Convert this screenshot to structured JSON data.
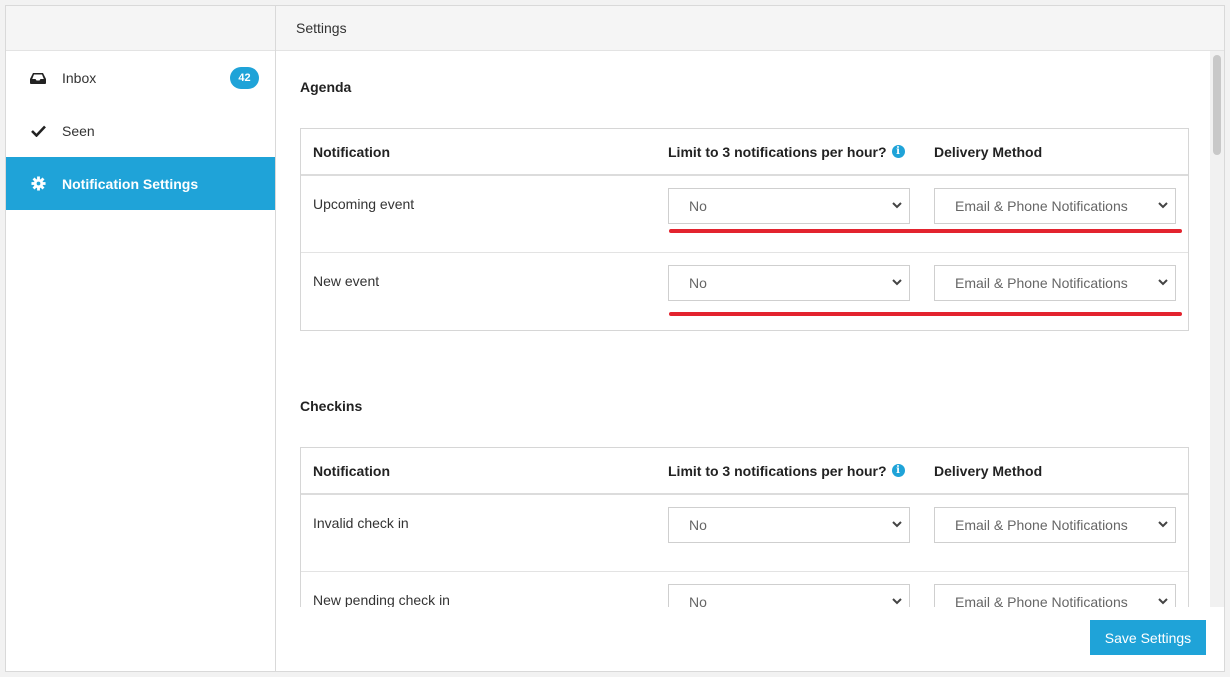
{
  "sidebar": {
    "items": [
      {
        "label": "Inbox",
        "icon": "inbox-icon",
        "badge": "42"
      },
      {
        "label": "Seen",
        "icon": "check-icon"
      },
      {
        "label": "Notification Settings",
        "icon": "gear-icon",
        "active": true
      }
    ]
  },
  "header": {
    "title": "Settings"
  },
  "columns": {
    "notification": "Notification",
    "limit": "Limit to 3 notifications per hour?",
    "delivery": "Delivery Method"
  },
  "sections": [
    {
      "title": "Agenda",
      "rows": [
        {
          "label": "Upcoming event",
          "limit": "No",
          "delivery": "Email & Phone Notifications"
        },
        {
          "label": "New event",
          "limit": "No",
          "delivery": "Email & Phone Notifications"
        }
      ]
    },
    {
      "title": "Checkins",
      "rows": [
        {
          "label": "Invalid check in",
          "limit": "No",
          "delivery": "Email & Phone Notifications"
        },
        {
          "label": "New pending check in",
          "limit": "No",
          "delivery": "Email & Phone Notifications"
        }
      ]
    }
  ],
  "save_label": "Save Settings",
  "colors": {
    "accent": "#1fa3d8",
    "annotation": "#e3232e"
  }
}
